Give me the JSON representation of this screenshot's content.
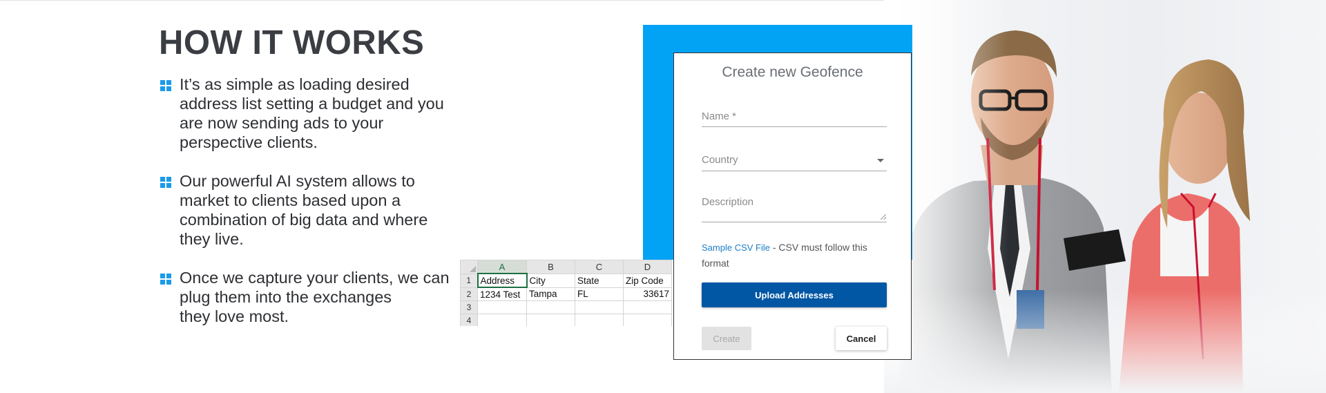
{
  "section": {
    "heading": "HOW IT WORKS",
    "bullets": [
      [
        "It’s as simple as loading desired",
        "address list setting a budget and you",
        "are now sending ads to your",
        "perspective clients."
      ],
      [
        "Our powerful AI system allows to",
        "market to clients based upon a",
        "combination of big data and where",
        "they live."
      ],
      [
        "Once we capture your clients, we can",
        "plug them into the exchanges",
        "they love most."
      ]
    ],
    "bullet_icon_color": "#1a9bea",
    "accent_color": "#02a2f5"
  },
  "spreadsheet": {
    "columns": [
      "A",
      "B",
      "C",
      "D"
    ],
    "row_numbers": [
      "1",
      "2",
      "3",
      "4"
    ],
    "rows": [
      [
        "Address",
        "City",
        "State",
        "Zip Code"
      ],
      [
        "1234 Test",
        "Tampa",
        "FL",
        "33617"
      ],
      [
        "",
        "",
        "",
        ""
      ],
      [
        "",
        "",
        "",
        ""
      ]
    ]
  },
  "modal": {
    "title": "Create new Geofence",
    "name_placeholder": "Name *",
    "country_placeholder": "Country",
    "description_placeholder": "Description",
    "csv_link": "Sample CSV File",
    "csv_note": " - CSV must follow this format",
    "upload_button": "Upload Addresses",
    "create_button": "Create",
    "cancel_button": "Cancel",
    "primary_color": "#0157a4"
  }
}
